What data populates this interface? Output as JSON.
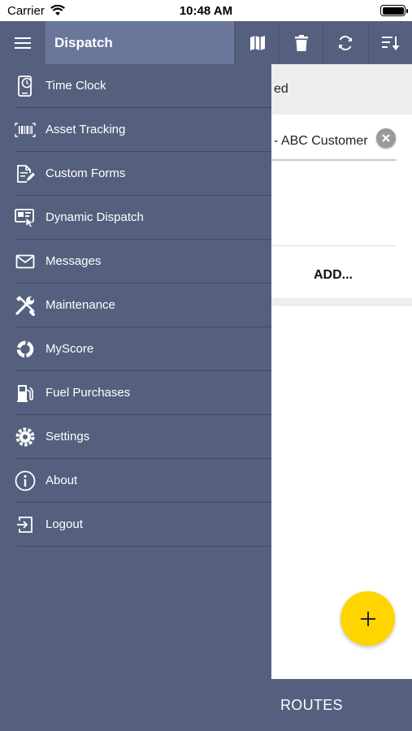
{
  "status_bar": {
    "carrier": "Carrier",
    "time": "10:48 AM"
  },
  "header": {
    "title": "Dispatch",
    "actions": [
      {
        "name": "map-icon"
      },
      {
        "name": "trash-icon"
      },
      {
        "name": "refresh-icon"
      },
      {
        "name": "sort-icon"
      }
    ]
  },
  "background": {
    "band_text": "ed",
    "field_value": "- ABC Customer",
    "add_label": "ADD...",
    "fab_icon": "plus-icon",
    "bottom_tab": "ROUTES"
  },
  "drawer": {
    "items": [
      {
        "label": "Time Clock",
        "icon": "time-clock-icon"
      },
      {
        "label": "Asset Tracking",
        "icon": "barcode-icon"
      },
      {
        "label": "Custom Forms",
        "icon": "form-edit-icon"
      },
      {
        "label": "Dynamic Dispatch",
        "icon": "dispatch-icon"
      },
      {
        "label": "Messages",
        "icon": "envelope-icon"
      },
      {
        "label": "Maintenance",
        "icon": "tools-icon"
      },
      {
        "label": "MyScore",
        "icon": "score-icon"
      },
      {
        "label": "Fuel Purchases",
        "icon": "fuel-pump-icon"
      },
      {
        "label": "Settings",
        "icon": "gear-icon"
      },
      {
        "label": "About",
        "icon": "info-icon"
      },
      {
        "label": "Logout",
        "icon": "logout-icon"
      }
    ]
  },
  "colors": {
    "header": "#55607f",
    "title_highlight": "#6b769b",
    "drawer": "#55607f",
    "fab": "#ffd500"
  }
}
